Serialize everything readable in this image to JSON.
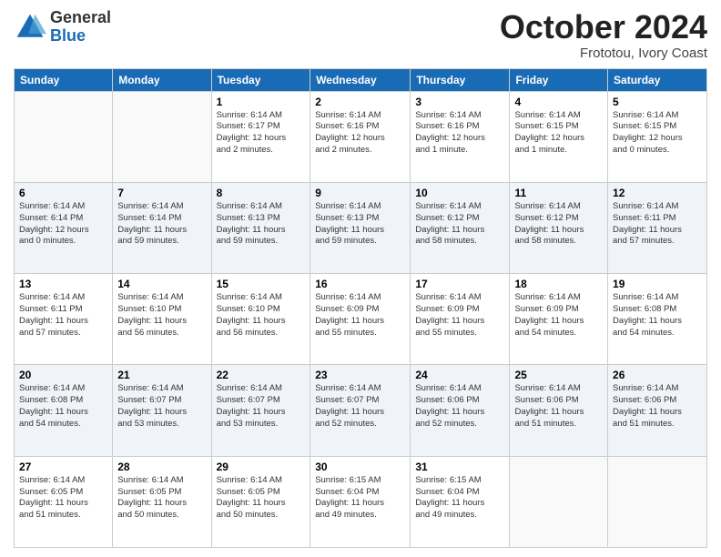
{
  "logo": {
    "general": "General",
    "blue": "Blue"
  },
  "title": "October 2024",
  "subtitle": "Frototou, Ivory Coast",
  "days_of_week": [
    "Sunday",
    "Monday",
    "Tuesday",
    "Wednesday",
    "Thursday",
    "Friday",
    "Saturday"
  ],
  "weeks": [
    [
      {
        "day": "",
        "info": ""
      },
      {
        "day": "",
        "info": ""
      },
      {
        "day": "1",
        "info": "Sunrise: 6:14 AM\nSunset: 6:17 PM\nDaylight: 12 hours\nand 2 minutes."
      },
      {
        "day": "2",
        "info": "Sunrise: 6:14 AM\nSunset: 6:16 PM\nDaylight: 12 hours\nand 2 minutes."
      },
      {
        "day": "3",
        "info": "Sunrise: 6:14 AM\nSunset: 6:16 PM\nDaylight: 12 hours\nand 1 minute."
      },
      {
        "day": "4",
        "info": "Sunrise: 6:14 AM\nSunset: 6:15 PM\nDaylight: 12 hours\nand 1 minute."
      },
      {
        "day": "5",
        "info": "Sunrise: 6:14 AM\nSunset: 6:15 PM\nDaylight: 12 hours\nand 0 minutes."
      }
    ],
    [
      {
        "day": "6",
        "info": "Sunrise: 6:14 AM\nSunset: 6:14 PM\nDaylight: 12 hours\nand 0 minutes."
      },
      {
        "day": "7",
        "info": "Sunrise: 6:14 AM\nSunset: 6:14 PM\nDaylight: 11 hours\nand 59 minutes."
      },
      {
        "day": "8",
        "info": "Sunrise: 6:14 AM\nSunset: 6:13 PM\nDaylight: 11 hours\nand 59 minutes."
      },
      {
        "day": "9",
        "info": "Sunrise: 6:14 AM\nSunset: 6:13 PM\nDaylight: 11 hours\nand 59 minutes."
      },
      {
        "day": "10",
        "info": "Sunrise: 6:14 AM\nSunset: 6:12 PM\nDaylight: 11 hours\nand 58 minutes."
      },
      {
        "day": "11",
        "info": "Sunrise: 6:14 AM\nSunset: 6:12 PM\nDaylight: 11 hours\nand 58 minutes."
      },
      {
        "day": "12",
        "info": "Sunrise: 6:14 AM\nSunset: 6:11 PM\nDaylight: 11 hours\nand 57 minutes."
      }
    ],
    [
      {
        "day": "13",
        "info": "Sunrise: 6:14 AM\nSunset: 6:11 PM\nDaylight: 11 hours\nand 57 minutes."
      },
      {
        "day": "14",
        "info": "Sunrise: 6:14 AM\nSunset: 6:10 PM\nDaylight: 11 hours\nand 56 minutes."
      },
      {
        "day": "15",
        "info": "Sunrise: 6:14 AM\nSunset: 6:10 PM\nDaylight: 11 hours\nand 56 minutes."
      },
      {
        "day": "16",
        "info": "Sunrise: 6:14 AM\nSunset: 6:09 PM\nDaylight: 11 hours\nand 55 minutes."
      },
      {
        "day": "17",
        "info": "Sunrise: 6:14 AM\nSunset: 6:09 PM\nDaylight: 11 hours\nand 55 minutes."
      },
      {
        "day": "18",
        "info": "Sunrise: 6:14 AM\nSunset: 6:09 PM\nDaylight: 11 hours\nand 54 minutes."
      },
      {
        "day": "19",
        "info": "Sunrise: 6:14 AM\nSunset: 6:08 PM\nDaylight: 11 hours\nand 54 minutes."
      }
    ],
    [
      {
        "day": "20",
        "info": "Sunrise: 6:14 AM\nSunset: 6:08 PM\nDaylight: 11 hours\nand 54 minutes."
      },
      {
        "day": "21",
        "info": "Sunrise: 6:14 AM\nSunset: 6:07 PM\nDaylight: 11 hours\nand 53 minutes."
      },
      {
        "day": "22",
        "info": "Sunrise: 6:14 AM\nSunset: 6:07 PM\nDaylight: 11 hours\nand 53 minutes."
      },
      {
        "day": "23",
        "info": "Sunrise: 6:14 AM\nSunset: 6:07 PM\nDaylight: 11 hours\nand 52 minutes."
      },
      {
        "day": "24",
        "info": "Sunrise: 6:14 AM\nSunset: 6:06 PM\nDaylight: 11 hours\nand 52 minutes."
      },
      {
        "day": "25",
        "info": "Sunrise: 6:14 AM\nSunset: 6:06 PM\nDaylight: 11 hours\nand 51 minutes."
      },
      {
        "day": "26",
        "info": "Sunrise: 6:14 AM\nSunset: 6:06 PM\nDaylight: 11 hours\nand 51 minutes."
      }
    ],
    [
      {
        "day": "27",
        "info": "Sunrise: 6:14 AM\nSunset: 6:05 PM\nDaylight: 11 hours\nand 51 minutes."
      },
      {
        "day": "28",
        "info": "Sunrise: 6:14 AM\nSunset: 6:05 PM\nDaylight: 11 hours\nand 50 minutes."
      },
      {
        "day": "29",
        "info": "Sunrise: 6:14 AM\nSunset: 6:05 PM\nDaylight: 11 hours\nand 50 minutes."
      },
      {
        "day": "30",
        "info": "Sunrise: 6:15 AM\nSunset: 6:04 PM\nDaylight: 11 hours\nand 49 minutes."
      },
      {
        "day": "31",
        "info": "Sunrise: 6:15 AM\nSunset: 6:04 PM\nDaylight: 11 hours\nand 49 minutes."
      },
      {
        "day": "",
        "info": ""
      },
      {
        "day": "",
        "info": ""
      }
    ]
  ]
}
